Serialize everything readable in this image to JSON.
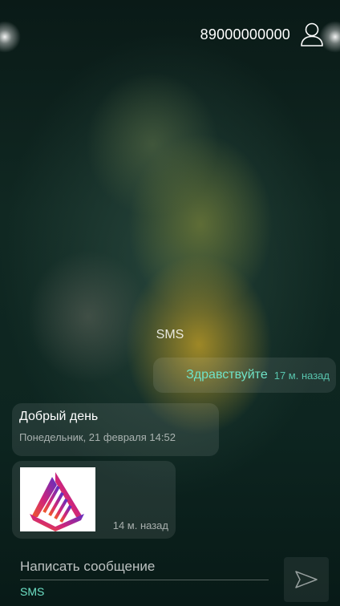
{
  "header": {
    "phone_number": "89000000000",
    "profile_icon": "user-icon"
  },
  "chat": {
    "channel_label": "SMS",
    "messages": [
      {
        "direction": "outgoing",
        "text": "Здравствуйте",
        "time": "17 м. назад"
      },
      {
        "direction": "incoming",
        "text": "Добрый день",
        "time": "Понедельник, 21 февраля 14:52"
      },
      {
        "direction": "incoming",
        "type": "image",
        "image_icon": "company-logo-image",
        "time": "14 м. назад"
      }
    ]
  },
  "composer": {
    "placeholder": "Написать сообщение",
    "value": "",
    "channel": "SMS",
    "send_icon": "send-icon"
  },
  "colors": {
    "accent": "#6fe3c8",
    "bubble": "rgba(255,255,255,0.09)"
  }
}
